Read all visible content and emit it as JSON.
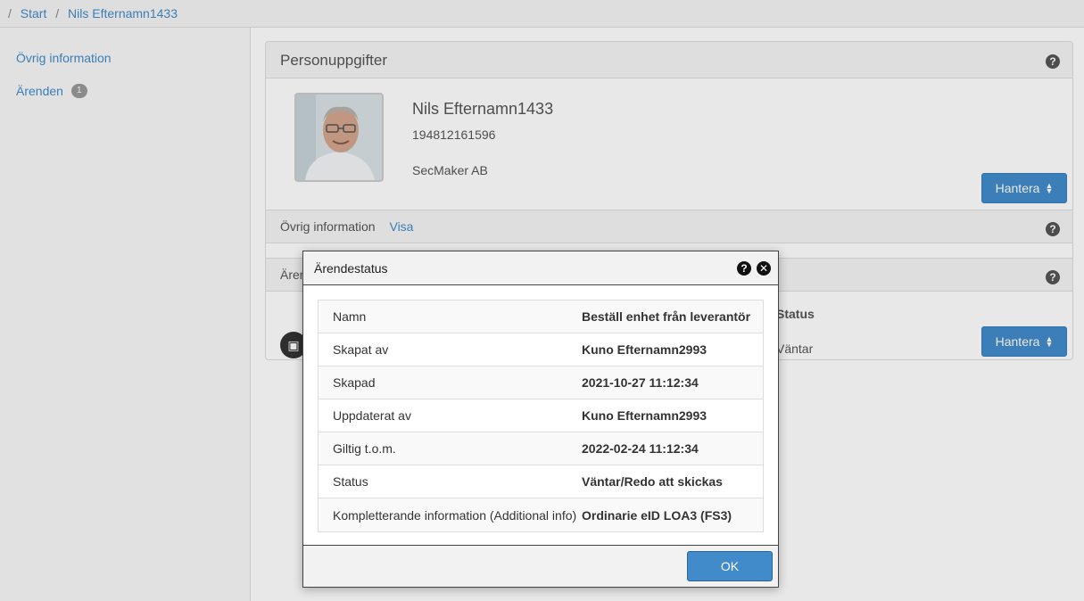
{
  "breadcrumb": {
    "separator": "/",
    "items": [
      "Start",
      "Nils Efternamn1433"
    ]
  },
  "sidebar": {
    "items": [
      {
        "label": "Övrig information"
      },
      {
        "label": "Ärenden",
        "badge": "1"
      }
    ]
  },
  "personuppgifter": {
    "title": "Personuppgifter",
    "name": "Nils Efternamn1433",
    "personal_number": "194812161596",
    "organization": "SecMaker AB",
    "manage_button": "Hantera"
  },
  "ovrig_information": {
    "label": "Övrig information",
    "link": "Visa"
  },
  "arenden_section": {
    "label": "Ären",
    "status_header": "Status",
    "status_value": "Väntar",
    "manage_button": "Hantera"
  },
  "modal": {
    "title": "Ärendestatus",
    "rows": [
      {
        "key": "Namn",
        "value": "Beställ enhet från leverantör"
      },
      {
        "key": "Skapat av",
        "value": "Kuno Efternamn2993"
      },
      {
        "key": "Skapad",
        "value": "2021-10-27 11:12:34"
      },
      {
        "key": "Uppdaterat av",
        "value": "Kuno Efternamn2993"
      },
      {
        "key": "Giltig t.o.m.",
        "value": "2022-02-24 11:12:34"
      },
      {
        "key": "Status",
        "value": "Väntar/Redo att skickas"
      },
      {
        "key": "Kompletterande information (Additional info)",
        "value": "Ordinarie eID LOA3 (FS3)"
      }
    ],
    "ok_button": "OK"
  },
  "colors": {
    "link": "#428bca",
    "primary_button": "#428bca"
  }
}
